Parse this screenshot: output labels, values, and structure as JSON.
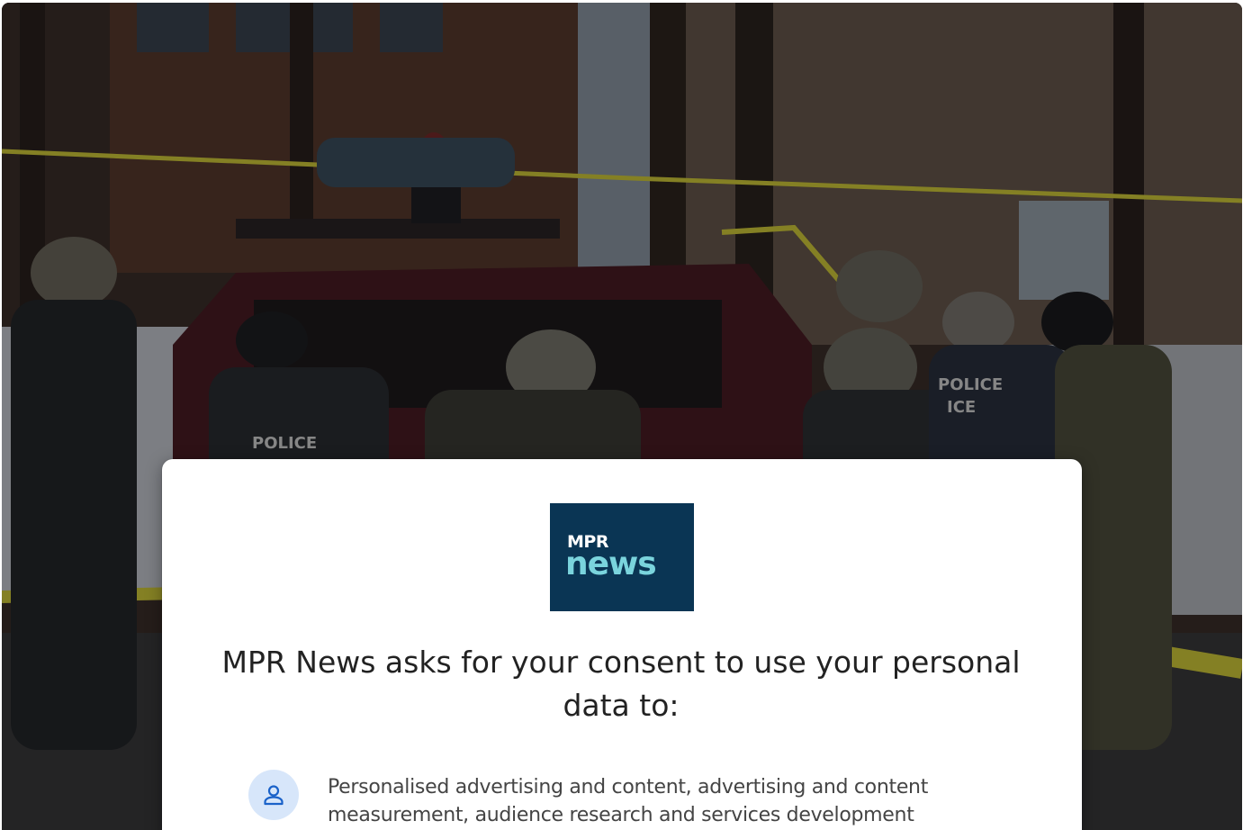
{
  "background": {
    "description_icon": "news-photo",
    "vest_labels": [
      "POLICE",
      "POLICE",
      "ICE"
    ]
  },
  "dialog": {
    "logo": {
      "line1": "MPR",
      "line2": "news",
      "bg_color": "#0a3554",
      "accent_color": "#7ad4dd"
    },
    "title": "MPR News asks for your consent to use your personal data to:",
    "purposes": [
      {
        "icon": "person-icon",
        "text": "Personalised advertising and content, advertising and content measurement, audience research and services development"
      }
    ]
  },
  "colors": {
    "dialog_bg": "#ffffff",
    "title_text": "#222222",
    "body_text": "#444444",
    "icon_circle": "#d7e6fa",
    "icon_stroke": "#1a62c9"
  }
}
